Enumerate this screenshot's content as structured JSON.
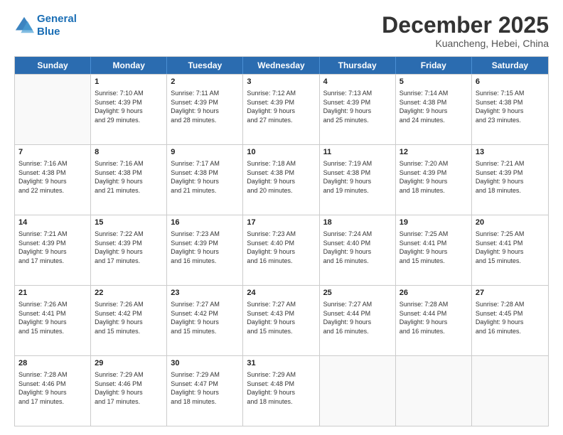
{
  "header": {
    "logo_line1": "General",
    "logo_line2": "Blue",
    "month_title": "December 2025",
    "location": "Kuancheng, Hebei, China"
  },
  "weekdays": [
    "Sunday",
    "Monday",
    "Tuesday",
    "Wednesday",
    "Thursday",
    "Friday",
    "Saturday"
  ],
  "rows": [
    [
      {
        "day": "",
        "info": ""
      },
      {
        "day": "1",
        "info": "Sunrise: 7:10 AM\nSunset: 4:39 PM\nDaylight: 9 hours\nand 29 minutes."
      },
      {
        "day": "2",
        "info": "Sunrise: 7:11 AM\nSunset: 4:39 PM\nDaylight: 9 hours\nand 28 minutes."
      },
      {
        "day": "3",
        "info": "Sunrise: 7:12 AM\nSunset: 4:39 PM\nDaylight: 9 hours\nand 27 minutes."
      },
      {
        "day": "4",
        "info": "Sunrise: 7:13 AM\nSunset: 4:39 PM\nDaylight: 9 hours\nand 25 minutes."
      },
      {
        "day": "5",
        "info": "Sunrise: 7:14 AM\nSunset: 4:38 PM\nDaylight: 9 hours\nand 24 minutes."
      },
      {
        "day": "6",
        "info": "Sunrise: 7:15 AM\nSunset: 4:38 PM\nDaylight: 9 hours\nand 23 minutes."
      }
    ],
    [
      {
        "day": "7",
        "info": "Sunrise: 7:16 AM\nSunset: 4:38 PM\nDaylight: 9 hours\nand 22 minutes."
      },
      {
        "day": "8",
        "info": "Sunrise: 7:16 AM\nSunset: 4:38 PM\nDaylight: 9 hours\nand 21 minutes."
      },
      {
        "day": "9",
        "info": "Sunrise: 7:17 AM\nSunset: 4:38 PM\nDaylight: 9 hours\nand 21 minutes."
      },
      {
        "day": "10",
        "info": "Sunrise: 7:18 AM\nSunset: 4:38 PM\nDaylight: 9 hours\nand 20 minutes."
      },
      {
        "day": "11",
        "info": "Sunrise: 7:19 AM\nSunset: 4:38 PM\nDaylight: 9 hours\nand 19 minutes."
      },
      {
        "day": "12",
        "info": "Sunrise: 7:20 AM\nSunset: 4:39 PM\nDaylight: 9 hours\nand 18 minutes."
      },
      {
        "day": "13",
        "info": "Sunrise: 7:21 AM\nSunset: 4:39 PM\nDaylight: 9 hours\nand 18 minutes."
      }
    ],
    [
      {
        "day": "14",
        "info": "Sunrise: 7:21 AM\nSunset: 4:39 PM\nDaylight: 9 hours\nand 17 minutes."
      },
      {
        "day": "15",
        "info": "Sunrise: 7:22 AM\nSunset: 4:39 PM\nDaylight: 9 hours\nand 17 minutes."
      },
      {
        "day": "16",
        "info": "Sunrise: 7:23 AM\nSunset: 4:39 PM\nDaylight: 9 hours\nand 16 minutes."
      },
      {
        "day": "17",
        "info": "Sunrise: 7:23 AM\nSunset: 4:40 PM\nDaylight: 9 hours\nand 16 minutes."
      },
      {
        "day": "18",
        "info": "Sunrise: 7:24 AM\nSunset: 4:40 PM\nDaylight: 9 hours\nand 16 minutes."
      },
      {
        "day": "19",
        "info": "Sunrise: 7:25 AM\nSunset: 4:41 PM\nDaylight: 9 hours\nand 15 minutes."
      },
      {
        "day": "20",
        "info": "Sunrise: 7:25 AM\nSunset: 4:41 PM\nDaylight: 9 hours\nand 15 minutes."
      }
    ],
    [
      {
        "day": "21",
        "info": "Sunrise: 7:26 AM\nSunset: 4:41 PM\nDaylight: 9 hours\nand 15 minutes."
      },
      {
        "day": "22",
        "info": "Sunrise: 7:26 AM\nSunset: 4:42 PM\nDaylight: 9 hours\nand 15 minutes."
      },
      {
        "day": "23",
        "info": "Sunrise: 7:27 AM\nSunset: 4:42 PM\nDaylight: 9 hours\nand 15 minutes."
      },
      {
        "day": "24",
        "info": "Sunrise: 7:27 AM\nSunset: 4:43 PM\nDaylight: 9 hours\nand 15 minutes."
      },
      {
        "day": "25",
        "info": "Sunrise: 7:27 AM\nSunset: 4:44 PM\nDaylight: 9 hours\nand 16 minutes."
      },
      {
        "day": "26",
        "info": "Sunrise: 7:28 AM\nSunset: 4:44 PM\nDaylight: 9 hours\nand 16 minutes."
      },
      {
        "day": "27",
        "info": "Sunrise: 7:28 AM\nSunset: 4:45 PM\nDaylight: 9 hours\nand 16 minutes."
      }
    ],
    [
      {
        "day": "28",
        "info": "Sunrise: 7:28 AM\nSunset: 4:46 PM\nDaylight: 9 hours\nand 17 minutes."
      },
      {
        "day": "29",
        "info": "Sunrise: 7:29 AM\nSunset: 4:46 PM\nDaylight: 9 hours\nand 17 minutes."
      },
      {
        "day": "30",
        "info": "Sunrise: 7:29 AM\nSunset: 4:47 PM\nDaylight: 9 hours\nand 18 minutes."
      },
      {
        "day": "31",
        "info": "Sunrise: 7:29 AM\nSunset: 4:48 PM\nDaylight: 9 hours\nand 18 minutes."
      },
      {
        "day": "",
        "info": ""
      },
      {
        "day": "",
        "info": ""
      },
      {
        "day": "",
        "info": ""
      }
    ]
  ]
}
